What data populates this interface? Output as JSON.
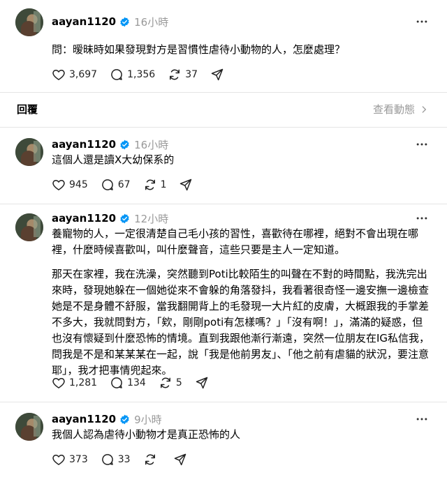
{
  "posts": [
    {
      "username": "aayan1120",
      "time": "16小時",
      "paragraphs": [
        "問：暧昧時如果發現對方是習慣性虐待小動物的人，怎麼處理？"
      ],
      "likes": "3,697",
      "comments": "1,356",
      "reposts": "37"
    },
    {
      "username": "aayan1120",
      "time": "16小時",
      "paragraphs": [
        "這個人還是讀X大幼保系的"
      ],
      "likes": "945",
      "comments": "67",
      "reposts": "1"
    },
    {
      "username": "aayan1120",
      "time": "12小時",
      "paragraphs": [
        "養寵物的人，一定很清楚自己毛小孩的習性，喜歡待在哪裡，絕對不會出現在哪裡，什麼時候喜歡叫，叫什麼聲音，這些只要是主人一定知道。",
        "那天在家裡，我在洗澡，突然聽到Poti比較陌生的叫聲在不對的時間點，我洗完出來時，發現她躲在一個她從來不會躲的角落發抖，我看著很奇怪一邊安撫一邊檢查她是不是身體不舒服，當我翻開背上的毛發現一大片紅的皮膚，大概跟我的手掌差不多大，我就問對方，「欸，剛剛poti有怎樣嗎？」「沒有啊！」，滿滿的疑惑，但也沒有懷疑到什麼恐怖的情境。直到我跟他漸行漸遠，突然一位朋友在IG私信我，問我是不是和某某某在一起，說「我是他前男友」、「他之前有虐貓的狀況，要注意耶」，我才把事情兜起來。"
      ],
      "likes": "1,281",
      "comments": "134",
      "reposts": "5"
    },
    {
      "username": "aayan1120",
      "time": "9小時",
      "paragraphs": [
        "我個人認為虐待小動物才是真正恐怖的人"
      ],
      "likes": "373",
      "comments": "33",
      "reposts": ""
    }
  ],
  "reply_bar": {
    "label": "回覆",
    "view_activity": "查看動態"
  },
  "colors": {
    "verified": "#0095f6",
    "muted": "#999999",
    "divider": "#e5e5e5"
  },
  "icons": [
    "heart-icon",
    "comment-icon",
    "repost-icon",
    "share-icon",
    "more-icon",
    "verified-badge-icon",
    "chevron-right-icon"
  ]
}
